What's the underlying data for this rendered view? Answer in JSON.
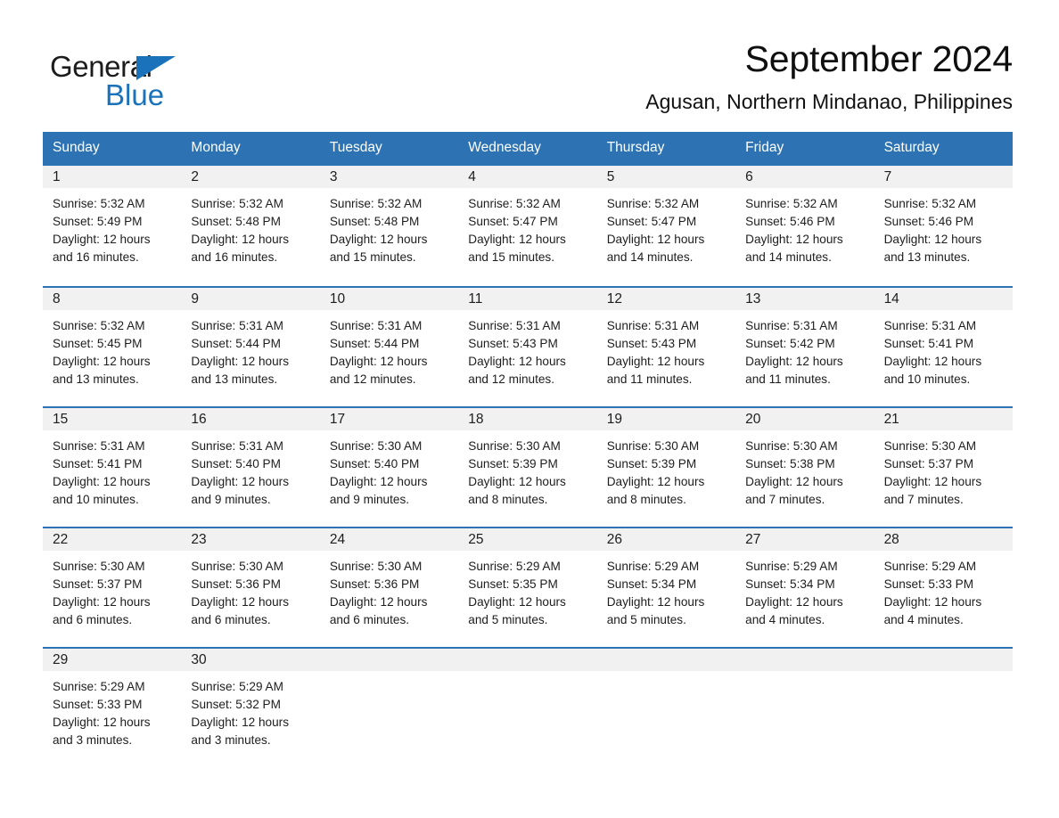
{
  "brand": {
    "name_part1": "General",
    "name_part2": "Blue",
    "accent_color": "#1a72ba"
  },
  "header": {
    "title": "September 2024",
    "location": "Agusan, Northern Mindanao, Philippines"
  },
  "calendar": {
    "header_bg": "#2d73b4",
    "daynum_bg": "#f1f1f1",
    "weekdays": [
      "Sunday",
      "Monday",
      "Tuesday",
      "Wednesday",
      "Thursday",
      "Friday",
      "Saturday"
    ],
    "weeks": [
      [
        {
          "day": "1",
          "sunrise": "Sunrise: 5:32 AM",
          "sunset": "Sunset: 5:49 PM",
          "daylight_line1": "Daylight: 12 hours",
          "daylight_line2": "and 16 minutes."
        },
        {
          "day": "2",
          "sunrise": "Sunrise: 5:32 AM",
          "sunset": "Sunset: 5:48 PM",
          "daylight_line1": "Daylight: 12 hours",
          "daylight_line2": "and 16 minutes."
        },
        {
          "day": "3",
          "sunrise": "Sunrise: 5:32 AM",
          "sunset": "Sunset: 5:48 PM",
          "daylight_line1": "Daylight: 12 hours",
          "daylight_line2": "and 15 minutes."
        },
        {
          "day": "4",
          "sunrise": "Sunrise: 5:32 AM",
          "sunset": "Sunset: 5:47 PM",
          "daylight_line1": "Daylight: 12 hours",
          "daylight_line2": "and 15 minutes."
        },
        {
          "day": "5",
          "sunrise": "Sunrise: 5:32 AM",
          "sunset": "Sunset: 5:47 PM",
          "daylight_line1": "Daylight: 12 hours",
          "daylight_line2": "and 14 minutes."
        },
        {
          "day": "6",
          "sunrise": "Sunrise: 5:32 AM",
          "sunset": "Sunset: 5:46 PM",
          "daylight_line1": "Daylight: 12 hours",
          "daylight_line2": "and 14 minutes."
        },
        {
          "day": "7",
          "sunrise": "Sunrise: 5:32 AM",
          "sunset": "Sunset: 5:46 PM",
          "daylight_line1": "Daylight: 12 hours",
          "daylight_line2": "and 13 minutes."
        }
      ],
      [
        {
          "day": "8",
          "sunrise": "Sunrise: 5:32 AM",
          "sunset": "Sunset: 5:45 PM",
          "daylight_line1": "Daylight: 12 hours",
          "daylight_line2": "and 13 minutes."
        },
        {
          "day": "9",
          "sunrise": "Sunrise: 5:31 AM",
          "sunset": "Sunset: 5:44 PM",
          "daylight_line1": "Daylight: 12 hours",
          "daylight_line2": "and 13 minutes."
        },
        {
          "day": "10",
          "sunrise": "Sunrise: 5:31 AM",
          "sunset": "Sunset: 5:44 PM",
          "daylight_line1": "Daylight: 12 hours",
          "daylight_line2": "and 12 minutes."
        },
        {
          "day": "11",
          "sunrise": "Sunrise: 5:31 AM",
          "sunset": "Sunset: 5:43 PM",
          "daylight_line1": "Daylight: 12 hours",
          "daylight_line2": "and 12 minutes."
        },
        {
          "day": "12",
          "sunrise": "Sunrise: 5:31 AM",
          "sunset": "Sunset: 5:43 PM",
          "daylight_line1": "Daylight: 12 hours",
          "daylight_line2": "and 11 minutes."
        },
        {
          "day": "13",
          "sunrise": "Sunrise: 5:31 AM",
          "sunset": "Sunset: 5:42 PM",
          "daylight_line1": "Daylight: 12 hours",
          "daylight_line2": "and 11 minutes."
        },
        {
          "day": "14",
          "sunrise": "Sunrise: 5:31 AM",
          "sunset": "Sunset: 5:41 PM",
          "daylight_line1": "Daylight: 12 hours",
          "daylight_line2": "and 10 minutes."
        }
      ],
      [
        {
          "day": "15",
          "sunrise": "Sunrise: 5:31 AM",
          "sunset": "Sunset: 5:41 PM",
          "daylight_line1": "Daylight: 12 hours",
          "daylight_line2": "and 10 minutes."
        },
        {
          "day": "16",
          "sunrise": "Sunrise: 5:31 AM",
          "sunset": "Sunset: 5:40 PM",
          "daylight_line1": "Daylight: 12 hours",
          "daylight_line2": "and 9 minutes."
        },
        {
          "day": "17",
          "sunrise": "Sunrise: 5:30 AM",
          "sunset": "Sunset: 5:40 PM",
          "daylight_line1": "Daylight: 12 hours",
          "daylight_line2": "and 9 minutes."
        },
        {
          "day": "18",
          "sunrise": "Sunrise: 5:30 AM",
          "sunset": "Sunset: 5:39 PM",
          "daylight_line1": "Daylight: 12 hours",
          "daylight_line2": "and 8 minutes."
        },
        {
          "day": "19",
          "sunrise": "Sunrise: 5:30 AM",
          "sunset": "Sunset: 5:39 PM",
          "daylight_line1": "Daylight: 12 hours",
          "daylight_line2": "and 8 minutes."
        },
        {
          "day": "20",
          "sunrise": "Sunrise: 5:30 AM",
          "sunset": "Sunset: 5:38 PM",
          "daylight_line1": "Daylight: 12 hours",
          "daylight_line2": "and 7 minutes."
        },
        {
          "day": "21",
          "sunrise": "Sunrise: 5:30 AM",
          "sunset": "Sunset: 5:37 PM",
          "daylight_line1": "Daylight: 12 hours",
          "daylight_line2": "and 7 minutes."
        }
      ],
      [
        {
          "day": "22",
          "sunrise": "Sunrise: 5:30 AM",
          "sunset": "Sunset: 5:37 PM",
          "daylight_line1": "Daylight: 12 hours",
          "daylight_line2": "and 6 minutes."
        },
        {
          "day": "23",
          "sunrise": "Sunrise: 5:30 AM",
          "sunset": "Sunset: 5:36 PM",
          "daylight_line1": "Daylight: 12 hours",
          "daylight_line2": "and 6 minutes."
        },
        {
          "day": "24",
          "sunrise": "Sunrise: 5:30 AM",
          "sunset": "Sunset: 5:36 PM",
          "daylight_line1": "Daylight: 12 hours",
          "daylight_line2": "and 6 minutes."
        },
        {
          "day": "25",
          "sunrise": "Sunrise: 5:29 AM",
          "sunset": "Sunset: 5:35 PM",
          "daylight_line1": "Daylight: 12 hours",
          "daylight_line2": "and 5 minutes."
        },
        {
          "day": "26",
          "sunrise": "Sunrise: 5:29 AM",
          "sunset": "Sunset: 5:34 PM",
          "daylight_line1": "Daylight: 12 hours",
          "daylight_line2": "and 5 minutes."
        },
        {
          "day": "27",
          "sunrise": "Sunrise: 5:29 AM",
          "sunset": "Sunset: 5:34 PM",
          "daylight_line1": "Daylight: 12 hours",
          "daylight_line2": "and 4 minutes."
        },
        {
          "day": "28",
          "sunrise": "Sunrise: 5:29 AM",
          "sunset": "Sunset: 5:33 PM",
          "daylight_line1": "Daylight: 12 hours",
          "daylight_line2": "and 4 minutes."
        }
      ],
      [
        {
          "day": "29",
          "sunrise": "Sunrise: 5:29 AM",
          "sunset": "Sunset: 5:33 PM",
          "daylight_line1": "Daylight: 12 hours",
          "daylight_line2": "and 3 minutes."
        },
        {
          "day": "30",
          "sunrise": "Sunrise: 5:29 AM",
          "sunset": "Sunset: 5:32 PM",
          "daylight_line1": "Daylight: 12 hours",
          "daylight_line2": "and 3 minutes."
        },
        {
          "day": "",
          "sunrise": "",
          "sunset": "",
          "daylight_line1": "",
          "daylight_line2": ""
        },
        {
          "day": "",
          "sunrise": "",
          "sunset": "",
          "daylight_line1": "",
          "daylight_line2": ""
        },
        {
          "day": "",
          "sunrise": "",
          "sunset": "",
          "daylight_line1": "",
          "daylight_line2": ""
        },
        {
          "day": "",
          "sunrise": "",
          "sunset": "",
          "daylight_line1": "",
          "daylight_line2": ""
        },
        {
          "day": "",
          "sunrise": "",
          "sunset": "",
          "daylight_line1": "",
          "daylight_line2": ""
        }
      ]
    ]
  }
}
